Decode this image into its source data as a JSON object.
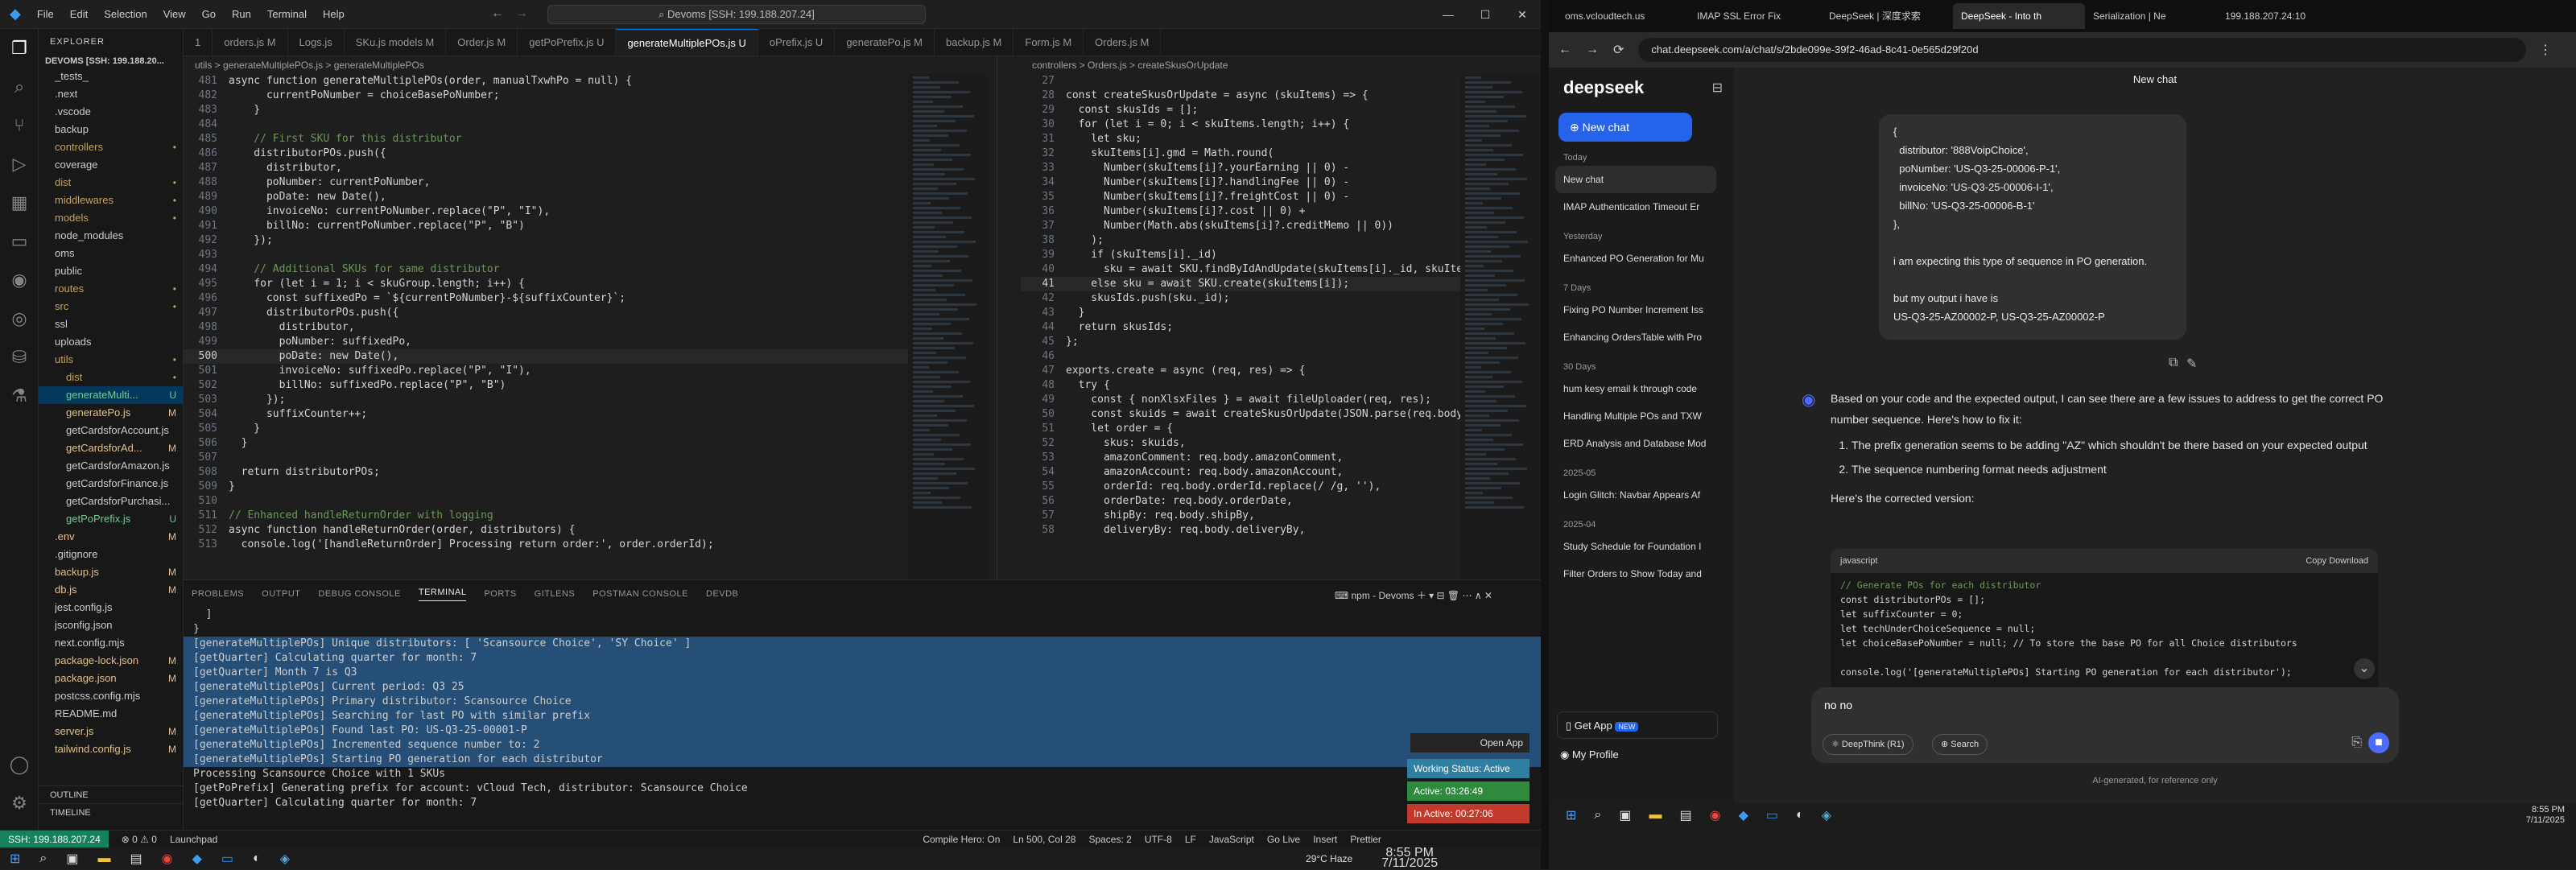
{
  "vscode": {
    "menu": [
      "File",
      "Edit",
      "Selection",
      "View",
      "Go",
      "Run",
      "Terminal",
      "Help"
    ],
    "command_center": "Devoms [SSH: 199.188.207.24]",
    "explorer_title": "EXPLORER",
    "workspace": "DEVOMS [SSH: 199.188.20...",
    "tree": [
      {
        "name": "_tests_",
        "badge": ""
      },
      {
        "name": ".next",
        "badge": ""
      },
      {
        "name": ".vscode",
        "badge": ""
      },
      {
        "name": "backup",
        "badge": ""
      },
      {
        "name": "controllers",
        "badge": "•"
      },
      {
        "name": "coverage",
        "badge": ""
      },
      {
        "name": "dist",
        "badge": "•"
      },
      {
        "name": "middlewares",
        "badge": "•"
      },
      {
        "name": "models",
        "badge": "•"
      },
      {
        "name": "node_modules",
        "badge": ""
      },
      {
        "name": "oms",
        "badge": ""
      },
      {
        "name": "public",
        "badge": ""
      },
      {
        "name": "routes",
        "badge": "•"
      },
      {
        "name": "src",
        "badge": "•"
      },
      {
        "name": "ssl",
        "badge": ""
      },
      {
        "name": "uploads",
        "badge": ""
      },
      {
        "name": "utils",
        "badge": "•"
      },
      {
        "name": "dist",
        "badge": "•"
      },
      {
        "name": "generateMulti...",
        "badge": "U"
      },
      {
        "name": "generatePo.js",
        "badge": "M"
      },
      {
        "name": "getCardsforAccount.js",
        "badge": ""
      },
      {
        "name": "getCardsforAd...",
        "badge": "M"
      },
      {
        "name": "getCardsforAmazon.js",
        "badge": ""
      },
      {
        "name": "getCardsforFinance.js",
        "badge": ""
      },
      {
        "name": "getCardsforPurchasi...",
        "badge": ""
      },
      {
        "name": "getPoPrefix.js",
        "badge": "U"
      },
      {
        "name": ".env",
        "badge": "M"
      },
      {
        "name": ".gitignore",
        "badge": ""
      },
      {
        "name": "backup.js",
        "badge": "M"
      },
      {
        "name": "db.js",
        "badge": "M"
      },
      {
        "name": "jest.config.js",
        "badge": ""
      },
      {
        "name": "jsconfig.json",
        "badge": ""
      },
      {
        "name": "next.config.mjs",
        "badge": ""
      },
      {
        "name": "package-lock.json",
        "badge": "M"
      },
      {
        "name": "package.json",
        "badge": "M"
      },
      {
        "name": "postcss.config.mjs",
        "badge": ""
      },
      {
        "name": "README.md",
        "badge": ""
      },
      {
        "name": "server.js",
        "badge": "M"
      },
      {
        "name": "tailwind.config.js",
        "badge": "M"
      }
    ],
    "outline": "OUTLINE",
    "timeline": "TIMELINE",
    "tabs": [
      "1",
      "orders.js M",
      "Logs.js",
      "SKu.js models M",
      "Order.js M",
      "getPoPrefix.js U",
      "generateMultiplePOs.js U",
      "oPrefix.js U",
      "generatePo.js M",
      "backup.js M",
      "Form.js M",
      "Orders.js M"
    ],
    "breadcrumb_left": "utils > generateMultiplePOs.js > generateMultiplePOs",
    "breadcrumb_right": "controllers > Orders.js > createSkusOrUpdate",
    "left_code": [
      {
        "n": "481",
        "t": "async function generateMultiplePOs(order, manualTxwhPo = null) {"
      },
      {
        "n": "482",
        "t": "      currentPoNumber = choiceBasePoNumber;"
      },
      {
        "n": "483",
        "t": "    }"
      },
      {
        "n": "484",
        "t": ""
      },
      {
        "n": "485",
        "t": "    // First SKU for this distributor"
      },
      {
        "n": "486",
        "t": "    distributorPOs.push({"
      },
      {
        "n": "487",
        "t": "      distributor,"
      },
      {
        "n": "488",
        "t": "      poNumber: currentPoNumber,"
      },
      {
        "n": "489",
        "t": "      poDate: new Date(),"
      },
      {
        "n": "490",
        "t": "      invoiceNo: currentPoNumber.replace(\"P\", \"I\"),"
      },
      {
        "n": "491",
        "t": "      billNo: currentPoNumber.replace(\"P\", \"B\")"
      },
      {
        "n": "492",
        "t": "    });"
      },
      {
        "n": "493",
        "t": ""
      },
      {
        "n": "494",
        "t": "    // Additional SKUs for same distributor"
      },
      {
        "n": "495",
        "t": "    for (let i = 1; i < skuGroup.length; i++) {"
      },
      {
        "n": "496",
        "t": "      const suffixedPo = `${currentPoNumber}-${suffixCounter}`;"
      },
      {
        "n": "497",
        "t": "      distributorPOs.push({"
      },
      {
        "n": "498",
        "t": "        distributor,"
      },
      {
        "n": "499",
        "t": "        poNumber: suffixedPo,"
      },
      {
        "n": "500",
        "t": "        poDate: new Date(),"
      },
      {
        "n": "501",
        "t": "        invoiceNo: suffixedPo.replace(\"P\", \"I\"),"
      },
      {
        "n": "502",
        "t": "        billNo: suffixedPo.replace(\"P\", \"B\")"
      },
      {
        "n": "503",
        "t": "      });"
      },
      {
        "n": "504",
        "t": "      suffixCounter++;"
      },
      {
        "n": "505",
        "t": "    }"
      },
      {
        "n": "506",
        "t": "  }"
      },
      {
        "n": "507",
        "t": ""
      },
      {
        "n": "508",
        "t": "  return distributorPOs;"
      },
      {
        "n": "509",
        "t": "}"
      },
      {
        "n": "510",
        "t": ""
      },
      {
        "n": "511",
        "t": "// Enhanced handleReturnOrder with logging"
      },
      {
        "n": "512",
        "t": "async function handleReturnOrder(order, distributors) {"
      },
      {
        "n": "513",
        "t": "  console.log('[handleReturnOrder] Processing return order:', order.orderId);"
      }
    ],
    "right_code": [
      {
        "n": "27",
        "t": ""
      },
      {
        "n": "28",
        "t": "const createSkusOrUpdate = async (skuItems) => {"
      },
      {
        "n": "29",
        "t": "  const skusIds = [];"
      },
      {
        "n": "30",
        "t": "  for (let i = 0; i < skuItems.length; i++) {"
      },
      {
        "n": "31",
        "t": "    let sku;"
      },
      {
        "n": "32",
        "t": "    skuItems[i].gmd = Math.round("
      },
      {
        "n": "33",
        "t": "      Number(skuItems[i]?.yourEarning || 0) -"
      },
      {
        "n": "34",
        "t": "      Number(skuItems[i]?.handlingFee || 0) -"
      },
      {
        "n": "35",
        "t": "      Number(skuItems[i]?.freightCost || 0) -"
      },
      {
        "n": "36",
        "t": "      Number(skuItems[i]?.cost || 0) +"
      },
      {
        "n": "37",
        "t": "      Number(Math.abs(skuItems[i]?.creditMemo || 0))"
      },
      {
        "n": "38",
        "t": "    );"
      },
      {
        "n": "39",
        "t": "    if (skuItems[i]._id)"
      },
      {
        "n": "40",
        "t": "      sku = await SKU.findByIdAndUpdate(skuItems[i]._id, skuItem"
      },
      {
        "n": "41",
        "t": "    else sku = await SKU.create(skuItems[i]);"
      },
      {
        "n": "42",
        "t": "    skusIds.push(sku._id);"
      },
      {
        "n": "43",
        "t": "  }"
      },
      {
        "n": "44",
        "t": "  return skusIds;"
      },
      {
        "n": "45",
        "t": "};"
      },
      {
        "n": "46",
        "t": ""
      },
      {
        "n": "47",
        "t": "exports.create = async (req, res) => {"
      },
      {
        "n": "48",
        "t": "  try {"
      },
      {
        "n": "49",
        "t": "    const { nonXlsxFiles } = await fileUploader(req, res);"
      },
      {
        "n": "50",
        "t": "    const skuids = await createSkusOrUpdate(JSON.parse(req.body.s"
      },
      {
        "n": "51",
        "t": "    let order = {"
      },
      {
        "n": "52",
        "t": "      skus: skuids,"
      },
      {
        "n": "53",
        "t": "      amazonComment: req.body.amazonComment,"
      },
      {
        "n": "54",
        "t": "      amazonAccount: req.body.amazonAccount,"
      },
      {
        "n": "55",
        "t": "      orderId: req.body.orderId.replace(/ /g, ''),"
      },
      {
        "n": "56",
        "t": "      orderDate: req.body.orderDate,"
      },
      {
        "n": "57",
        "t": "      shipBy: req.body.shipBy,"
      },
      {
        "n": "58",
        "t": "      deliveryBy: req.body.deliveryBy,"
      }
    ],
    "panel_tabs": [
      "PROBLEMS",
      "OUTPUT",
      "DEBUG CONSOLE",
      "TERMINAL",
      "PORTS",
      "GITLENS",
      "POSTMAN CONSOLE",
      "DEVDB"
    ],
    "terminal_name": "npm - Devoms",
    "terminal": [
      "  ]",
      "}",
      "[generateMultiplePOs] Unique distributors: [ 'Scansource Choice', 'SY Choice' ]",
      "[getQuarter] Calculating quarter for month: 7",
      "[getQuarter] Month 7 is Q3",
      "[generateMultiplePOs] Current period: Q3 25",
      "[generateMultiplePOs] Primary distributor: Scansource Choice",
      "[generateMultiplePOs] Searching for last PO with similar prefix",
      "[generateMultiplePOs] Found last PO: US-Q3-25-00001-P",
      "[generateMultiplePOs] Incremented sequence number to: 2",
      "[generateMultiplePOs] Starting PO generation for each distributor",
      "Processing Scansource Choice with 1 SKUs",
      "[getPoPrefix] Generating prefix for account: vCloud Tech, distributor: Scansource Choice",
      "[getQuarter] Calculating quarter for month: 7"
    ],
    "open_app": "Open App",
    "working_status": "Working Status: Active",
    "active": "Active: 03:26:49",
    "inactive": "In Active: 00:27:06",
    "status": {
      "remote": "SSH: 199.188.207.24",
      "branch": "Launchpad",
      "compile": "Compile Hero: On",
      "pos": "Ln 500, Col 28",
      "spaces": "Spaces: 2",
      "enc": "UTF-8",
      "eol": "LF",
      "lang": "JavaScript",
      "golive": "Go Live",
      "insert": "Insert",
      "prettier": "Prettier"
    },
    "weather": "29°C Haze",
    "time": "8:55 PM",
    "date": "7/11/2025"
  },
  "browser": {
    "tabs": [
      "oms.vcloudtech.us",
      "IMAP SSL Error Fix",
      "DeepSeek | 深度求索",
      "DeepSeek - Into th",
      "Serialization | Ne",
      "199.188.207.24:10"
    ],
    "url": "chat.deepseek.com/a/chat/s/2bde099e-39f2-46ad-8c41-0e565d29f20d",
    "logo": "deepseek",
    "new_chat": "New chat",
    "title": "New chat",
    "groups": [
      {
        "label": "Today",
        "items": [
          "New chat",
          "IMAP Authentication Timeout Er"
        ]
      },
      {
        "label": "Yesterday",
        "items": [
          "Enhanced PO Generation for Mu"
        ]
      },
      {
        "label": "7 Days",
        "items": [
          "Fixing PO Number Increment Iss",
          "Enhancing OrdersTable with Pro"
        ]
      },
      {
        "label": "30 Days",
        "items": [
          "hum kesy email k through code",
          "Handling Multiple POs and TXW",
          "ERD Analysis and Database Mod"
        ]
      },
      {
        "label": "2025-05",
        "items": [
          "Login Glitch: Navbar Appears Af"
        ]
      },
      {
        "label": "2025-04",
        "items": [
          "Study Schedule for Foundation I",
          "Filter Orders to Show Today and"
        ]
      }
    ],
    "get_app": "Get App",
    "new_badge": "NEW",
    "profile": "My Profile",
    "user_msg": [
      "{",
      "  distributor: '888VoipChoice',",
      "  poNumber: 'US-Q3-25-00006-P-1',",
      "  invoiceNo: 'US-Q3-25-00006-I-1',",
      "  billNo: 'US-Q3-25-00006-B-1'",
      "},",
      "",
      "i am expecting this type of sequence in PO generation.",
      "",
      "but my output i have is",
      "US-Q3-25-AZ00002-P, US-Q3-25-AZ00002-P"
    ],
    "intro": "Based on your code and the expected output, I can see there are a few issues to address to get the correct PO number sequence. Here's how to fix it:",
    "points": [
      "The prefix generation seems to be adding \"AZ\" which shouldn't be there based on your expected output",
      "The sequence numbering format needs adjustment"
    ],
    "here": "Here's the corrected version:",
    "code_lang": "javascript",
    "copy": "Copy",
    "download": "Download",
    "code": [
      "// Generate POs for each distributor",
      "const distributorPOs = [];",
      "let suffixCounter = 0;",
      "let techUnderChoiceSequence = null;",
      "let choiceBasePoNumber = null; // To store the base PO for all Choice distributors",
      "",
      "console.log('[generateMultiplePOs] Starting PO generation for each distributor');"
    ],
    "input": "no no",
    "deepthink": "DeepThink (R1)",
    "search": "Search",
    "disclaimer": "AI-generated, for reference only",
    "time": "8:55 PM",
    "date": "7/11/2025"
  }
}
